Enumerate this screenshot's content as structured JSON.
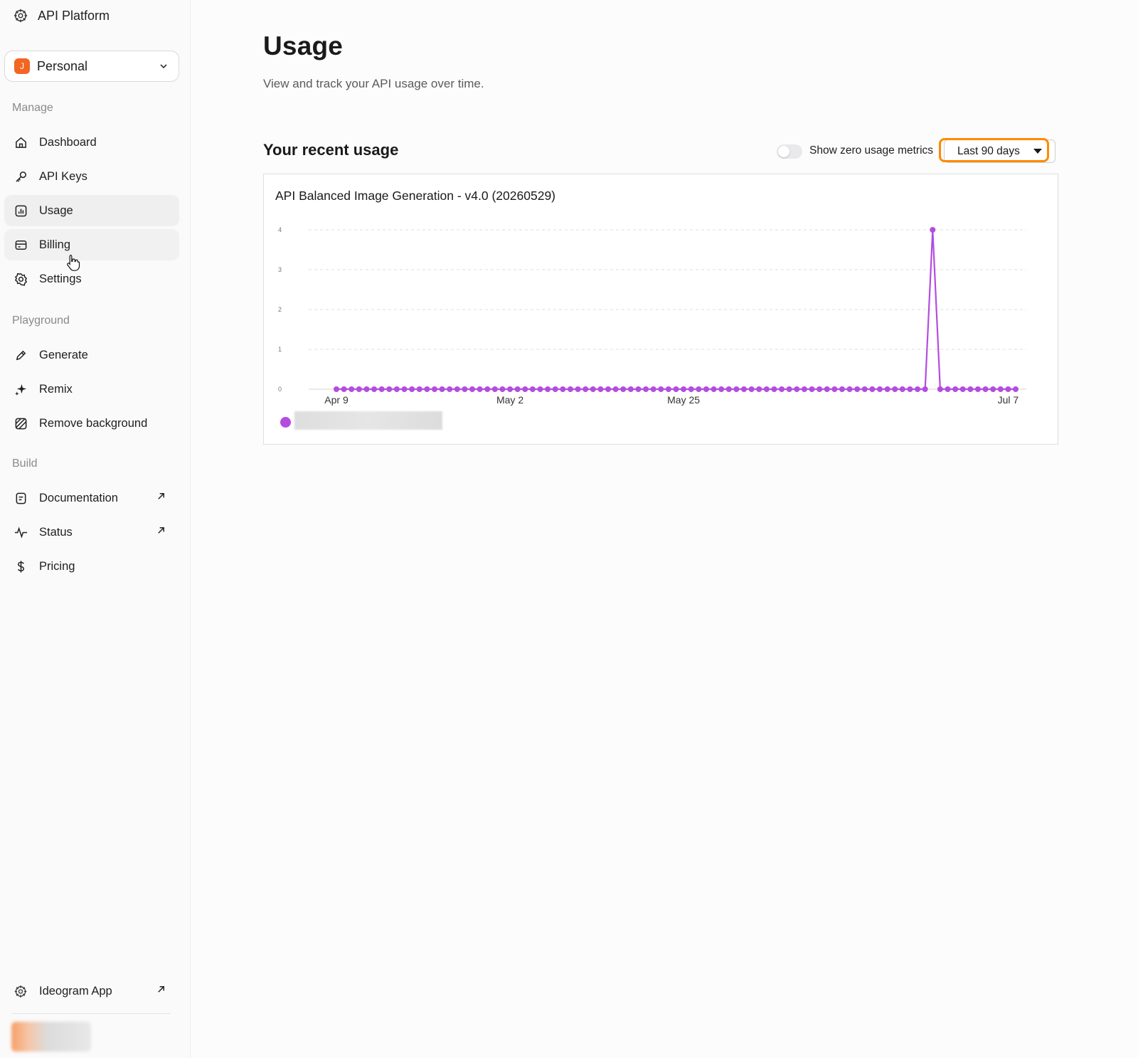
{
  "sidebar": {
    "brand": "API Platform",
    "org": {
      "initial": "J",
      "name": "Personal"
    },
    "sections": {
      "manage": "Manage",
      "playground": "Playground",
      "build": "Build"
    },
    "manage_items": [
      {
        "label": "Dashboard",
        "icon": "home-icon"
      },
      {
        "label": "API Keys",
        "icon": "key-icon"
      },
      {
        "label": "Usage",
        "icon": "bar-chart-icon"
      },
      {
        "label": "Billing",
        "icon": "credit-card-icon"
      },
      {
        "label": "Settings",
        "icon": "gear-icon"
      }
    ],
    "playground_items": [
      {
        "label": "Generate",
        "icon": "pencil-icon"
      },
      {
        "label": "Remix",
        "icon": "sparkle-icon"
      },
      {
        "label": "Remove background",
        "icon": "eraser-icon"
      }
    ],
    "build_items": [
      {
        "label": "Documentation",
        "icon": "document-icon",
        "external": true
      },
      {
        "label": "Status",
        "icon": "activity-icon",
        "external": true
      },
      {
        "label": "Pricing",
        "icon": "dollar-icon",
        "external": false
      }
    ],
    "footer_app": "Ideogram App"
  },
  "main": {
    "title": "Usage",
    "subtitle": "View and track your API usage over time.",
    "recent_title": "Your recent usage",
    "toggle_label": "Show zero usage metrics",
    "toggle_on": false,
    "range_selected": "Last 90 days"
  },
  "colors": {
    "accent": "#b44ce0",
    "highlight": "#ff8a00",
    "org_badge": "#f26522"
  },
  "chart_data": {
    "type": "line",
    "title": "API Balanced Image Generation - v4.0 (20260529)",
    "x_start": "Apr 9",
    "x_end": "Jul 7",
    "x_ticks": [
      "Apr 9",
      "May 2",
      "May 25",
      "Jul 7"
    ],
    "ylim": [
      0,
      4
    ],
    "y_ticks": [
      0,
      1,
      2,
      3,
      4
    ],
    "grid": true,
    "series": [
      {
        "values": [
          0,
          0,
          0,
          0,
          0,
          0,
          0,
          0,
          0,
          0,
          0,
          0,
          0,
          0,
          0,
          0,
          0,
          0,
          0,
          0,
          0,
          0,
          0,
          0,
          0,
          0,
          0,
          0,
          0,
          0,
          0,
          0,
          0,
          0,
          0,
          0,
          0,
          0,
          0,
          0,
          0,
          0,
          0,
          0,
          0,
          0,
          0,
          0,
          0,
          0,
          0,
          0,
          0,
          0,
          0,
          0,
          0,
          0,
          0,
          0,
          0,
          0,
          0,
          0,
          0,
          0,
          0,
          0,
          0,
          0,
          0,
          0,
          0,
          0,
          0,
          0,
          0,
          0,
          0,
          4,
          0,
          0,
          0,
          0,
          0,
          0,
          0,
          0,
          0,
          0,
          0
        ]
      }
    ]
  }
}
